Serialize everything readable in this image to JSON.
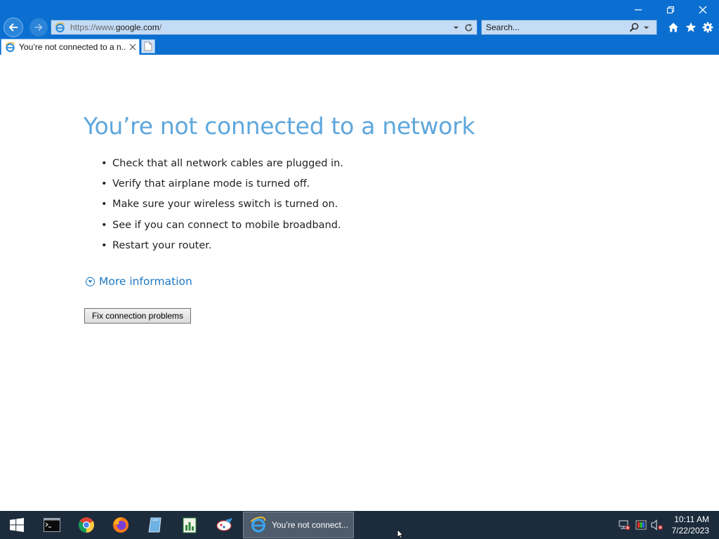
{
  "browser": {
    "url_prefix": "https://www.",
    "url_host": "google.com",
    "url_suffix": "/",
    "search_placeholder": "Search...",
    "tab_title": "You’re not connected to a n..."
  },
  "page": {
    "title": "You’re not connected to a network",
    "tips": [
      "Check that all network cables are plugged in.",
      "Verify that airplane mode is turned off.",
      "Make sure your wireless switch is turned on.",
      "See if you can connect to mobile broadband.",
      "Restart your router."
    ],
    "more_info": "More information",
    "fix_button": "Fix connection problems"
  },
  "taskbar": {
    "active_task": "You’re not connect...",
    "time": "10:11 AM",
    "date": "7/22/2023"
  },
  "colors": {
    "chrome": "#0a6fd1",
    "title": "#5ea7dd",
    "link": "#1f78c1",
    "taskbar": "#1c2c3d"
  }
}
